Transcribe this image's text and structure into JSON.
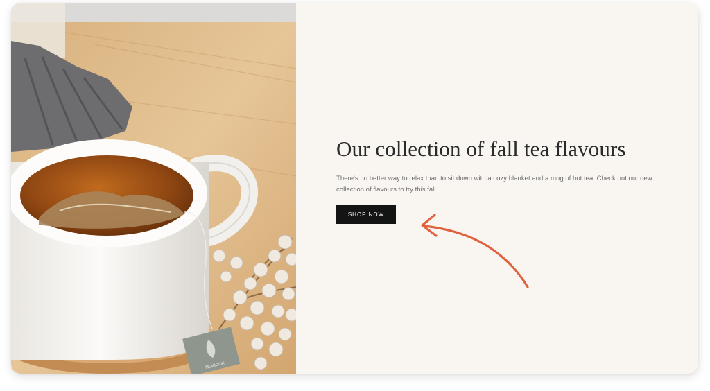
{
  "hero": {
    "title": "Our collection of fall tea flavours",
    "description": "There's no better way to relax than to sit down with a cozy blanket and a mug of hot tea. Check out our new collection of flavours to try this fall.",
    "cta_label": "SHOP NOW",
    "tea_tag_text": "TEABOOK"
  },
  "colors": {
    "panel_background": "#f9f6f1",
    "button_background": "#141414",
    "button_text": "#ffffff",
    "arrow": "#e0633f",
    "title": "#2a2a2a",
    "body_text": "#6b6b6b"
  },
  "icons": {
    "annotation": "curved-arrow-icon"
  }
}
